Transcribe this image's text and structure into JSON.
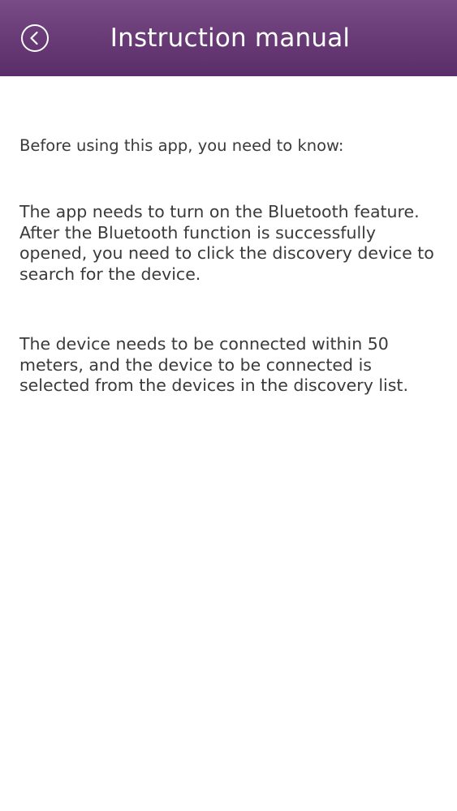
{
  "header": {
    "title": "Instruction manual",
    "back_icon": "back-arrow-circle-icon",
    "background_top": "#7a4c86",
    "background_bottom": "#5a2e68",
    "title_color": "#ffffff"
  },
  "content": {
    "intro": "Before using this app, you need to know:",
    "paragraphs": [
      "The app needs to turn on the Bluetooth feature. After the Bluetooth function is successfully opened, you need to click the discovery device to search for the device.",
      "The device needs to be connected within 50 meters, and the device to be connected is selected from the devices in the discovery list."
    ],
    "text_color": "#3a3a3a"
  }
}
